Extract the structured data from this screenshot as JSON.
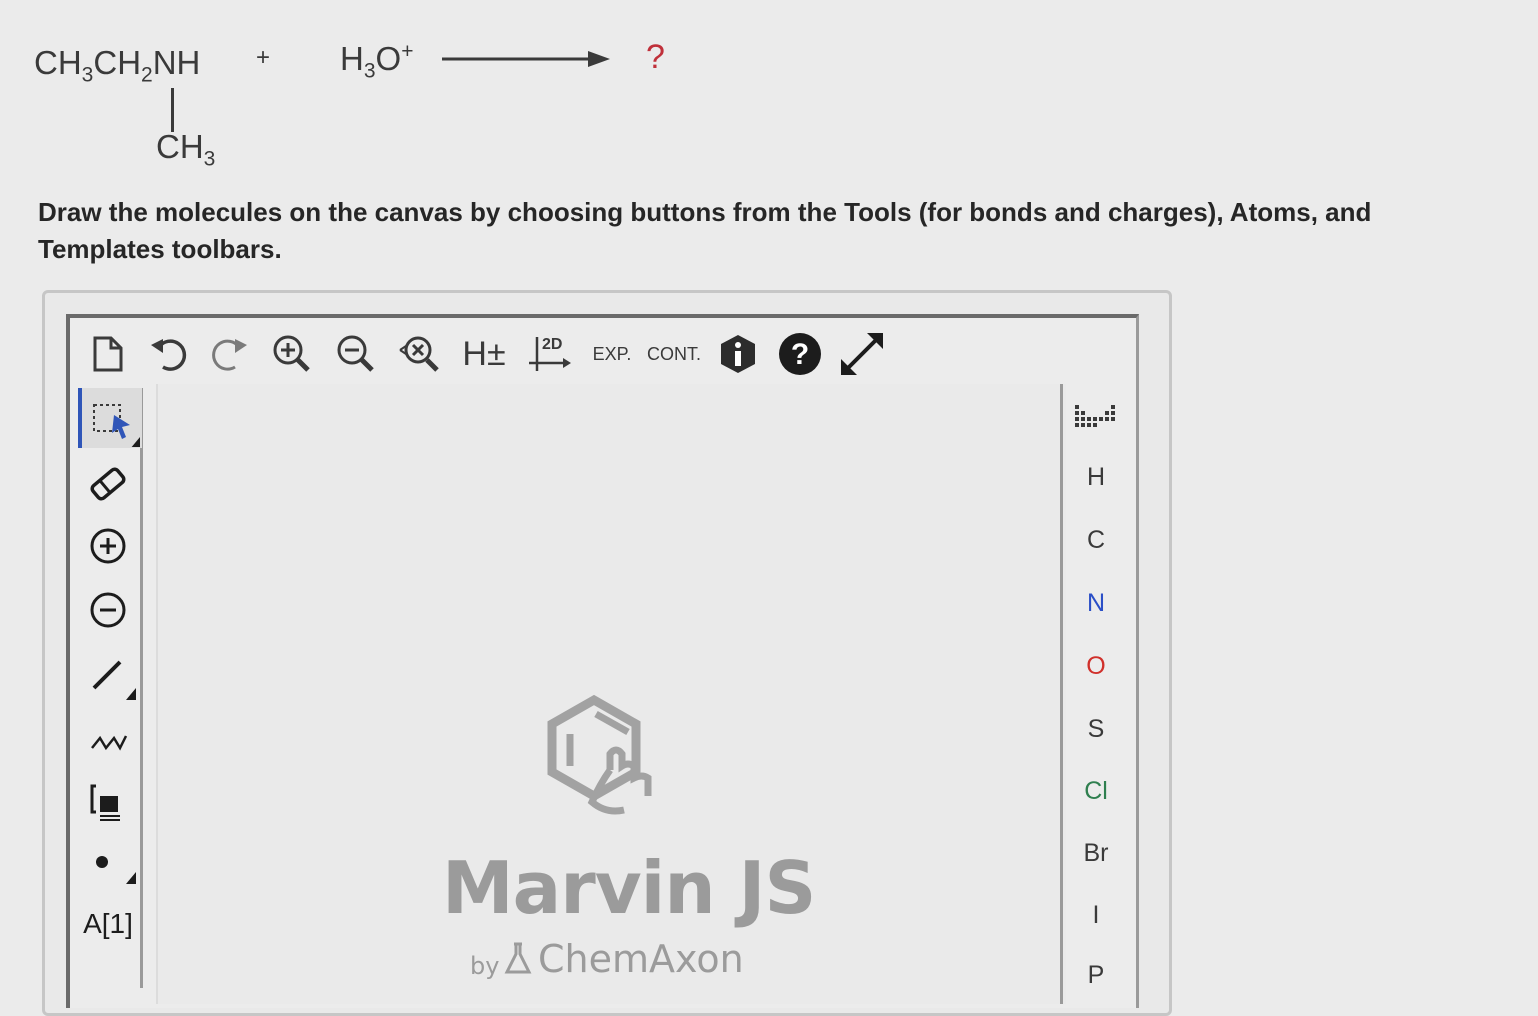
{
  "reaction": {
    "reactant1_main": "CH3CH2NH",
    "reactant1_branch": "CH3",
    "plus": "+",
    "reactant2": "H3O+",
    "product": "?"
  },
  "prompt": "Draw the molecules on the canvas by choosing buttons from the Tools (for bonds and charges), Atoms, and Templates toolbars.",
  "toolbar_top": {
    "h_toggle_label": "H±",
    "clean2d_label": "2D",
    "expand_label": "EXP.",
    "contract_label": "CONT.",
    "info_label": "i",
    "help_label": "?"
  },
  "toolbar_left": {
    "attached_data_label": "A[1]"
  },
  "atoms": [
    "H",
    "C",
    "N",
    "O",
    "S",
    "Cl",
    "Br",
    "I",
    "P"
  ],
  "colors": {
    "nitrogen": "#2b4fc7",
    "oxygen": "#d0302b",
    "sulfur": "#3a3a3a",
    "chlorine": "#2f7f4f",
    "bromine": "#3a3a3a",
    "iodine": "#3a3a3a",
    "hydrogen": "#3a3a3a",
    "carbon": "#3a3a3a",
    "phosphorus": "#3a3a3a",
    "product_question": "#c0303a",
    "selected_tool_accent": "#2f55b8"
  },
  "canvas": {
    "brand_title": "Marvin JS",
    "brand_by": "by",
    "brand_company": "ChemAxon"
  }
}
